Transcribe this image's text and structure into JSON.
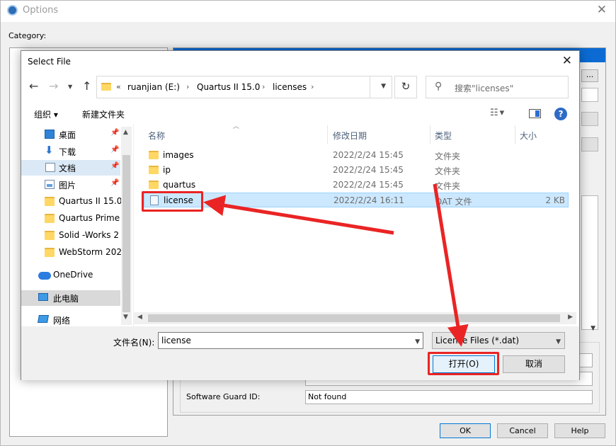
{
  "options_window": {
    "title": "Options",
    "close_glyph": "✕",
    "category_label": "Category:",
    "browse_label": "...",
    "software_guard_label": "Software Guard ID:",
    "software_guard_value": "Not found",
    "license_field_2_value": "",
    "buttons": {
      "ok": "OK",
      "cancel": "Cancel",
      "help": "Help"
    }
  },
  "select_file_dialog": {
    "title": "Select File",
    "close_glyph": "✕",
    "address_bar": {
      "overflow": "«",
      "breadcrumbs": [
        "ruanjian (E:)",
        "Quartus II 15.0",
        "licenses"
      ],
      "separator": "›"
    },
    "search": {
      "placeholder": "搜索\"licenses\""
    },
    "toolbar": {
      "organize": "组织 ▾",
      "new_folder": "新建文件夹",
      "help": "?"
    },
    "nav_pane": {
      "items": [
        {
          "label": "桌面",
          "icon": "desktop-icon",
          "pinned": true
        },
        {
          "label": "下载",
          "icon": "download-icon",
          "pinned": true
        },
        {
          "label": "文档",
          "icon": "documents-icon",
          "pinned": true
        },
        {
          "label": "图片",
          "icon": "pictures-icon",
          "pinned": true
        },
        {
          "label": "Quartus II 15.0",
          "icon": "folder-icon",
          "pinned": false
        },
        {
          "label": "Quartus Prime",
          "icon": "folder-icon",
          "pinned": false
        },
        {
          "label": "Solid -Works 2",
          "icon": "folder-icon",
          "pinned": false
        },
        {
          "label": "WebStorm 202",
          "icon": "folder-icon",
          "pinned": false
        },
        {
          "label": "OneDrive",
          "icon": "onedrive-icon",
          "pinned": false
        },
        {
          "label": "此电脑",
          "icon": "this-pc-icon",
          "pinned": false
        },
        {
          "label": "网络",
          "icon": "network-icon",
          "pinned": false
        }
      ]
    },
    "file_list": {
      "columns": [
        "名称",
        "修改日期",
        "类型",
        "大小"
      ],
      "rows": [
        {
          "name": "images",
          "date": "2022/2/24 15:45",
          "type": "文件夹",
          "size": "",
          "kind": "folder"
        },
        {
          "name": "ip",
          "date": "2022/2/24 15:45",
          "type": "文件夹",
          "size": "",
          "kind": "folder"
        },
        {
          "name": "quartus",
          "date": "2022/2/24 15:45",
          "type": "文件夹",
          "size": "",
          "kind": "folder"
        },
        {
          "name": "license",
          "date": "2022/2/24 16:11",
          "type": "DAT 文件",
          "size": "2 KB",
          "kind": "file",
          "selected": true
        }
      ]
    },
    "bottom": {
      "filename_label": "文件名(N):",
      "filename_value": "license",
      "filetype_value": "License Files (*.dat)",
      "open_button": "打开(O)",
      "cancel_button": "取消"
    }
  },
  "annotation": {
    "color": "#ea2424"
  }
}
